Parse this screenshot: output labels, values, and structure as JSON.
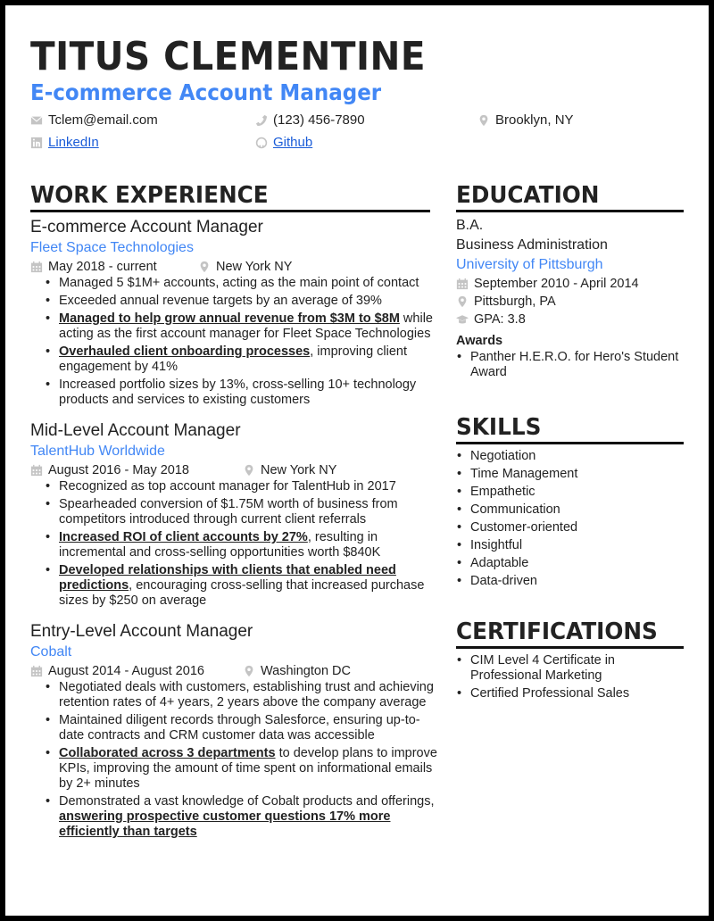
{
  "header": {
    "name": "TITUS CLEMENTINE",
    "title": "E-commerce Account Manager",
    "contacts": {
      "email": {
        "icon": "envelope-icon",
        "text": "Tclem@email.com"
      },
      "phone": {
        "icon": "phone-icon",
        "text": "(123) 456-7890"
      },
      "location": {
        "icon": "map-pin-icon",
        "text": "Brooklyn, NY"
      },
      "linkedin": {
        "icon": "linkedin-icon",
        "text": "LinkedIn"
      },
      "github": {
        "icon": "github-icon",
        "text": "Github"
      }
    }
  },
  "work": {
    "heading": "WORK EXPERIENCE",
    "jobs": [
      {
        "title": "E-commerce Account Manager",
        "company": "Fleet Space Technologies",
        "dates": "May 2018 - current",
        "location": "New York NY",
        "bullets": [
          {
            "bold": "",
            "text": "Managed 5 $1M+ accounts, acting as the main point of contact"
          },
          {
            "bold": "",
            "text": "Exceeded annual revenue targets by an average of 39%"
          },
          {
            "bold": "Managed to help grow annual revenue from $3M to $8M",
            "text": " while acting as the first account manager for Fleet Space Technologies"
          },
          {
            "bold": "Overhauled client onboarding processes",
            "text": ", improving client engagement by 41%"
          },
          {
            "bold": "",
            "text": "Increased portfolio sizes by 13%, cross-selling 10+ technology products and services to existing customers"
          }
        ]
      },
      {
        "title": "Mid-Level Account Manager",
        "company": "TalentHub Worldwide",
        "dates": "August 2016 - May 2018",
        "location": "New York NY",
        "bullets": [
          {
            "bold": "",
            "text": "Recognized as top account manager for TalentHub in 2017"
          },
          {
            "bold": "",
            "text": "Spearheaded conversion of $1.75M worth of business from competitors introduced through current client referrals"
          },
          {
            "bold": "Increased ROI of client accounts by 27%",
            "text": ", resulting in incremental and cross-selling opportunities worth $840K"
          },
          {
            "bold": "Developed relationships with clients that enabled need predictions",
            "text": ", encouraging cross-selling that increased purchase sizes by $250 on average"
          }
        ]
      },
      {
        "title": "Entry-Level Account Manager",
        "company": "Cobalt",
        "dates": "August 2014 - August 2016",
        "location": "Washington DC",
        "bullets": [
          {
            "bold": "",
            "text": "Negotiated deals with customers, establishing trust and achieving retention rates of 4+ years, 2 years above the company average"
          },
          {
            "bold": "",
            "text": "Maintained diligent records through Salesforce, ensuring up-to-date contracts and CRM customer data was accessible"
          },
          {
            "bold": "Collaborated across 3 departments",
            "text": " to develop plans to improve KPIs, improving the amount of time spent on informational emails by 2+ minutes"
          },
          {
            "prefix": "Demonstrated a vast knowledge of Cobalt products and offerings, ",
            "bold": "answering prospective customer questions 17% more efficiently than targets",
            "text": ""
          }
        ]
      }
    ]
  },
  "education": {
    "heading": "EDUCATION",
    "degree": "B.A.",
    "field": "Business Administration",
    "school": "University of Pittsburgh",
    "dates": "September 2010 - April 2014",
    "location": "Pittsburgh, PA",
    "gpa": "GPA: 3.8",
    "awards_heading": "Awards",
    "awards": [
      "Panther H.E.R.O. for Hero's Student Award"
    ]
  },
  "skills": {
    "heading": "SKILLS",
    "items": [
      "Negotiation",
      "Time Management",
      "Empathetic",
      "Communication",
      "Customer-oriented",
      "Insightful",
      "Adaptable",
      "Data-driven"
    ]
  },
  "certifications": {
    "heading": "CERTIFICATIONS",
    "items": [
      "CIM Level 4 Certificate in Professional Marketing",
      "Certified Professional Sales"
    ]
  },
  "colors": {
    "accent": "#4287f5",
    "text": "#222222",
    "icon": "#c4c4c4",
    "border": "#000000"
  }
}
